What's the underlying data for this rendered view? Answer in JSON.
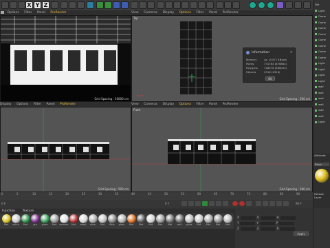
{
  "toolbar": {
    "axis_buttons": [
      "X",
      "Y",
      "Z"
    ]
  },
  "viewport_menu": [
    "View",
    "Cameras",
    "Display",
    "Options",
    "Filter",
    "Panel",
    "ProRender"
  ],
  "viewports": [
    {
      "label": "",
      "grid_spacing": "Grid Spacing : 10000 cm"
    },
    {
      "label": "Top",
      "grid_spacing": "Grid Spacing : 500 cm"
    },
    {
      "label": "Front",
      "grid_spacing": "Grid Spacing : 500 cm"
    },
    {
      "label": "Front",
      "grid_spacing": "Grid Spacing : 500 cm"
    }
  ],
  "info_dialog": {
    "title": "Information",
    "rows": [
      {
        "k": "Memory",
        "v": "ca. 10477 KBytes"
      },
      {
        "k": "Points",
        "v": "731784 (876864)"
      },
      {
        "k": "Polygons",
        "v": "718576 (666032)"
      },
      {
        "k": "Objects",
        "v": "2316 (2316)"
      }
    ],
    "ok": "OK"
  },
  "timeline": {
    "ticks": [
      "0",
      "5",
      "10",
      "15",
      "20",
      "25",
      "30",
      "35",
      "40",
      "45",
      "50",
      "55",
      "60",
      "65",
      "70",
      "75",
      "80",
      "85",
      "90"
    ],
    "current": "0 F",
    "start": "0 F",
    "end": "90 F"
  },
  "material_menu": [
    "Create",
    "Edit",
    "Function",
    "Texture"
  ],
  "materials": [
    {
      "name": "Mat",
      "color": "#d8c020"
    },
    {
      "name": "sahrb",
      "color": "#c9c9c9"
    },
    {
      "name": "Mat",
      "color": "#2a8f4a"
    },
    {
      "name": "gre",
      "color": "#7a2a8a"
    },
    {
      "name": "glass",
      "color": "#3aa05a"
    },
    {
      "name": "Mat",
      "color": "#9a9a9a"
    },
    {
      "name": "ceramic",
      "color": "#e0e0e0"
    },
    {
      "name": "Mat",
      "color": "#b03030"
    },
    {
      "name": "sabot",
      "color": "#d8d8d8"
    },
    {
      "name": "alum",
      "color": "#aaaaaa"
    },
    {
      "name": "Mat",
      "color": "#c0c0c0"
    },
    {
      "name": "floor",
      "color": "#888888"
    },
    {
      "name": "glass",
      "color": "#b0b0b0"
    },
    {
      "name": "Mat",
      "color": "#e07020"
    },
    {
      "name": "Mat",
      "color": "#5a5a5a"
    },
    {
      "name": "Mat",
      "color": "#d0d0d0"
    },
    {
      "name": "Mat",
      "color": "#9a9a9a"
    },
    {
      "name": "Mat",
      "color": "#707070"
    },
    {
      "name": "wall",
      "color": "#6a6a6a"
    },
    {
      "name": "glass",
      "color": "#bbbbbb"
    },
    {
      "name": "Mat",
      "color": "#c8c8c8"
    },
    {
      "name": "Mat",
      "color": "#a8a8a8"
    },
    {
      "name": "Mat",
      "color": "#909090"
    },
    {
      "name": "Mat",
      "color": "#b8b8b8"
    }
  ],
  "coords": {
    "rows": [
      {
        "a": "X",
        "b": "X",
        "c": "H"
      },
      {
        "a": "Y",
        "b": "Y",
        "c": "P"
      },
      {
        "a": "Z",
        "b": "Z",
        "c": "B"
      }
    ],
    "apply": "Apply"
  },
  "objects": [
    "File",
    "Light",
    "Came",
    "Came",
    "Came",
    "Came",
    "Came",
    "Came",
    "Came",
    "Came",
    "Light",
    "Light",
    "Light",
    "Light",
    "wall",
    "wall",
    "wall",
    "wall",
    "wall",
    "wall",
    "Light"
  ],
  "attributes": {
    "title": "Attribute",
    "tab": "Basic",
    "subtitle": "Default Layer"
  }
}
